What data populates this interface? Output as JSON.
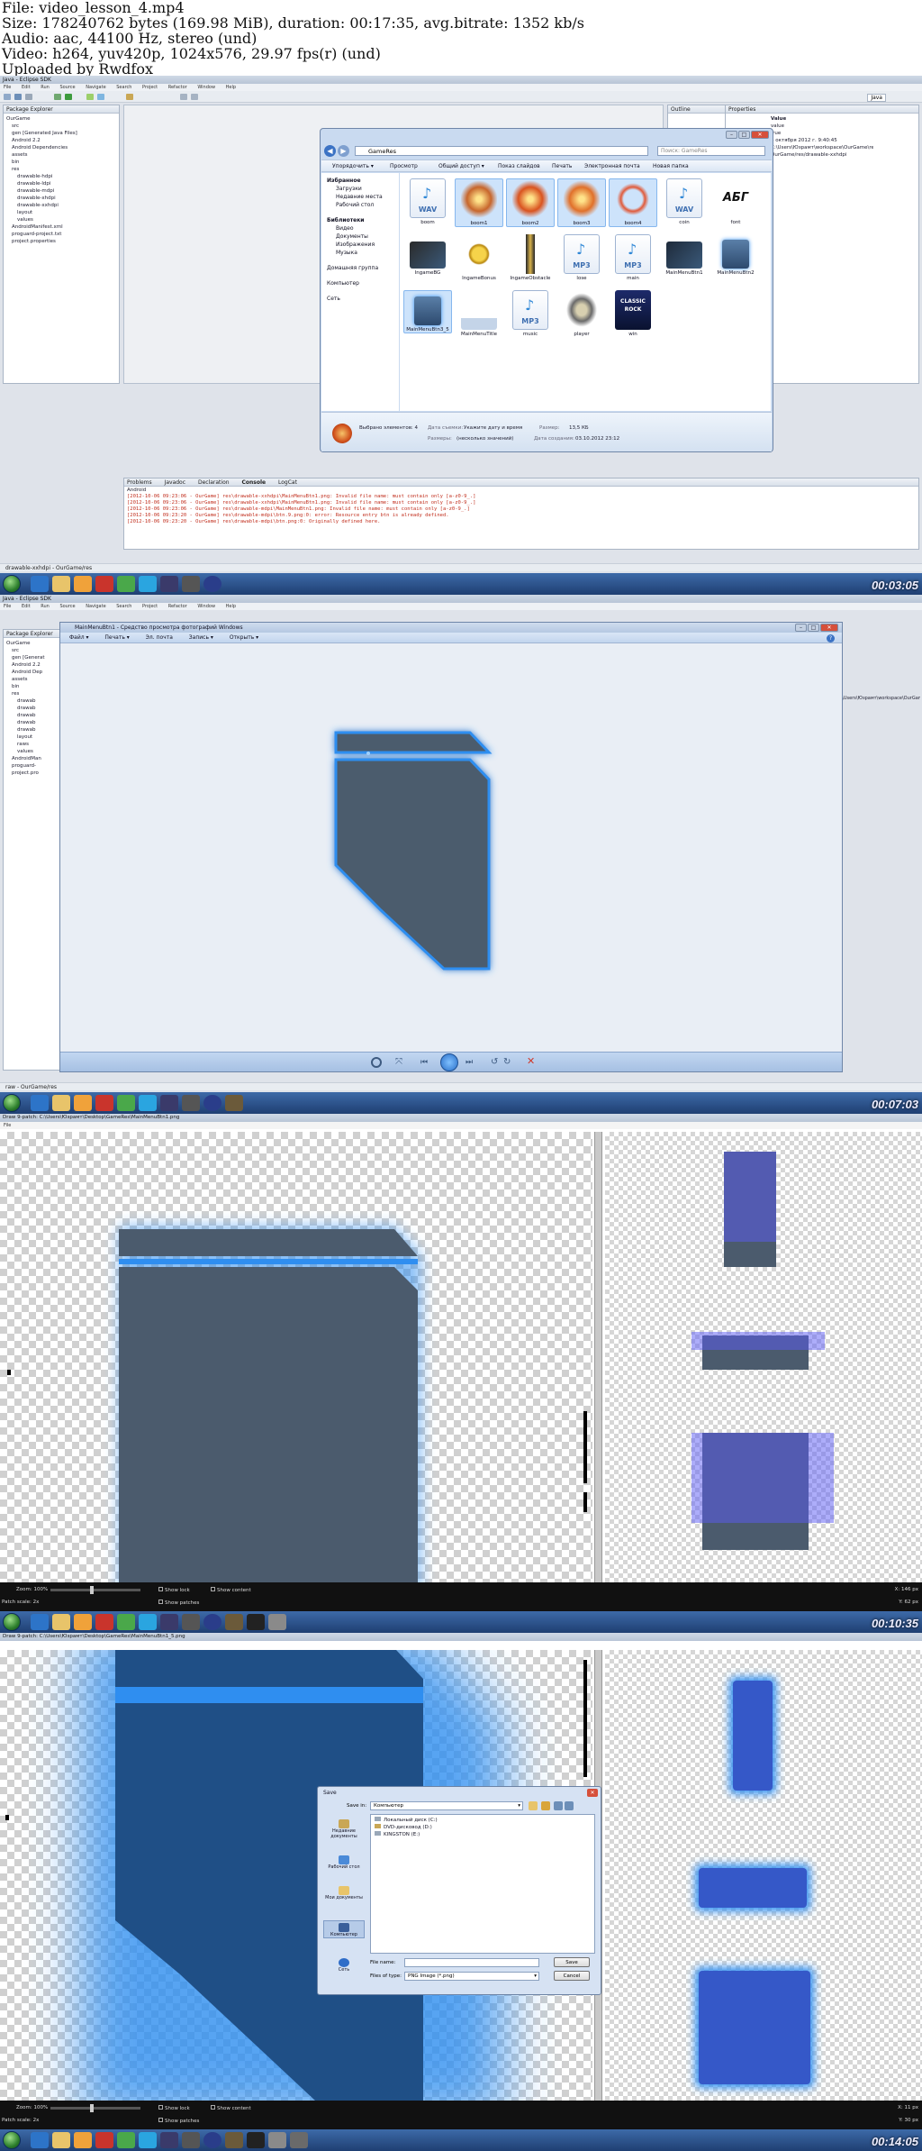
{
  "header": {
    "file": "File: video_lesson_4.mp4",
    "size": "Size: 178240762 bytes (169.98 MiB), duration: 00:17:35, avg.bitrate: 1352 kb/s",
    "audio": "Audio: aac, 44100 Hz, stereo (und)",
    "video": "Video: h264, yuv420p, 1024x576, 29.97 fps(r) (und)",
    "uploader": "Uploaded by Rwdfox"
  },
  "frame1": {
    "window_title": "Java - Eclipse SDK",
    "menu": [
      "File",
      "Edit",
      "Run",
      "Source",
      "Navigate",
      "Search",
      "Project",
      "Refactor",
      "Window",
      "Help"
    ],
    "perspective": "Java",
    "package_explorer": {
      "title": "Package Explorer",
      "items": [
        "OurGame",
        "src",
        "gen [Generated Java Files]",
        "Android 2.2",
        "Android Dependencies",
        "assets",
        "bin",
        "res",
        "drawable-hdpi",
        "drawable-ldpi",
        "drawable-mdpi",
        "drawable-xhdpi",
        "drawable-xxhdpi",
        "layout",
        "values",
        "AndroidManifest.xml",
        "proguard-project.txt",
        "project.properties"
      ]
    },
    "outline_tab": "Outline",
    "properties_tab": "Properties",
    "properties": {
      "header": "Value",
      "values": [
        "value",
        "true",
        "6 октября 2012 г. 9:40:45",
        "C:\\Users\\Юзрамт\\workspace\\OurGame\\res\\drawable",
        "OurGame/res/drawable-xxhdpi"
      ]
    },
    "explorer": {
      "path": "GameRes",
      "search_placeholder": "Поиск: GameRes",
      "toolbar": [
        "Упорядочить ▾",
        "Просмотр",
        "Общий доступ ▾",
        "Показ слайдов",
        "Печать",
        "Электронная почта",
        "Новая папка"
      ],
      "nav": {
        "favorites": "Избранное",
        "fav_items": [
          "Загрузки",
          "Недавние места",
          "Рабочий стол"
        ],
        "libraries": "Библиотеки",
        "lib_items": [
          "Видео",
          "Документы",
          "Изображения",
          "Музыка"
        ],
        "homegroup": "Домашняя группа",
        "computer": "Компьютер",
        "network": "Сеть"
      },
      "files": [
        "boom",
        "boom1",
        "boom2",
        "boom3",
        "boom4",
        "coin",
        "font",
        "IngameBG",
        "IngameBonus",
        "IngameObstacle",
        "lose",
        "main",
        "MainMenuBtn1",
        "MainMenuBtn2",
        "MainMenuBtn3_5",
        "MainMenuTitle",
        "music",
        "player",
        "win"
      ],
      "status": {
        "selected": "Выбрано элементов: 4",
        "date_label": "Дата съемки:",
        "date_value": "Укажите дату и время",
        "size_label": "Размер:",
        "size_value": "13,5 КБ",
        "dims_label": "Размеры:",
        "dims_value": "(несколько значений)",
        "created_label": "Дата создания:",
        "created_value": "03.10.2012 23:12"
      }
    },
    "console": {
      "tabs": [
        "Problems",
        "Javadoc",
        "Declaration",
        "Console",
        "LogCat"
      ],
      "title": "Android",
      "lines": [
        "[2012-10-06 09:23:06 - OurGame] res\\drawable-xxhdpi\\MainMenuBtn1.png: Invalid file name: must contain only [a-z0-9_.]",
        "[2012-10-06 09:23:06 - OurGame] res\\drawable-xxhdpi\\MainMenuBtn1.png: Invalid file name: must contain only [a-z0-9_.]",
        "[2012-10-06 09:23:06 - OurGame] res\\drawable-mdpi\\MainMenuBtn1.png: Invalid file name: must contain only [a-z0-9_.]",
        "[2012-10-06 09:23:20 - OurGame] res\\drawable-mdpi\\btn.9.png:0: error: Resource entry btn is already defined.",
        "[2012-10-06 09:23:20 - OurGame] res\\drawable-mdpi\\btn.png:0: Originally defined here."
      ]
    },
    "status": "drawable-xxhdpi - OurGame/res",
    "timestamp": "00:03:05"
  },
  "frame2": {
    "window_title": "Java - Eclipse SDK",
    "viewer_title": "MainMenuBtn1 - Средство просмотра фотографий Windows",
    "viewer_menu": [
      "Файл ▾",
      "Печать ▾",
      "Эл. почта",
      "Запись ▾",
      "Открыть ▾"
    ],
    "package_explorer": {
      "title": "Package Explorer",
      "items": [
        "OurGame",
        "src",
        "gen [Generat",
        "Android 2.2",
        "Android Dep",
        "assets",
        "bin",
        "res",
        "drawab",
        "drawab",
        "drawab",
        "drawab",
        "drawab",
        "layout",
        "raws",
        "values",
        "AndroidMan",
        "proguard-",
        "project.pro"
      ]
    },
    "right_path": "C:\\Users\\Юзрамт\\workspace\\OurGame\\res\\raw",
    "status": "raw - OurGame/res",
    "timestamp": "00:07:03"
  },
  "frame3": {
    "title": "Draw 9-patch: C:\\Users\\Юзрамт\\Desktop\\GameRes\\MainMenuBtn1.png",
    "menu": "File",
    "zoom_label": "Zoom: 100%",
    "patch_scale_label": "Patch scale: 2x",
    "show_lock": "Show lock",
    "show_patches": "Show patches",
    "show_content": "Show content",
    "coords": "X: 146 px",
    "coords2": "Y: 62 px",
    "timestamp": "00:10:35"
  },
  "frame4": {
    "title": "Draw 9-patch: C:\\Users\\Юзрамт\\Desktop\\GameRes\\MainMenuBtn1_5.png",
    "save_dialog": {
      "title": "Save",
      "save_in_label": "Save in:",
      "save_in_value": "Компьютер",
      "places": [
        "Недавние документы",
        "Рабочий стол",
        "Мои документы",
        "Компьютер",
        "Сеть"
      ],
      "drives": [
        "Локальный диск (C:)",
        "DVD-дисковод (D:)",
        "KINGSTON (E:)"
      ],
      "file_name_label": "File name:",
      "file_name_value": "",
      "file_type_label": "Files of type:",
      "file_type_value": "PNG Image (*.png)",
      "save_button": "Save",
      "cancel_button": "Cancel"
    },
    "zoom_label": "Zoom: 100%",
    "patch_scale_label": "Patch scale: 2x",
    "show_lock": "Show lock",
    "show_patches": "Show patches",
    "show_content": "Show content",
    "coords": "X: 11 px",
    "coords2": "Y: 30 px",
    "timestamp": "00:14:05"
  }
}
